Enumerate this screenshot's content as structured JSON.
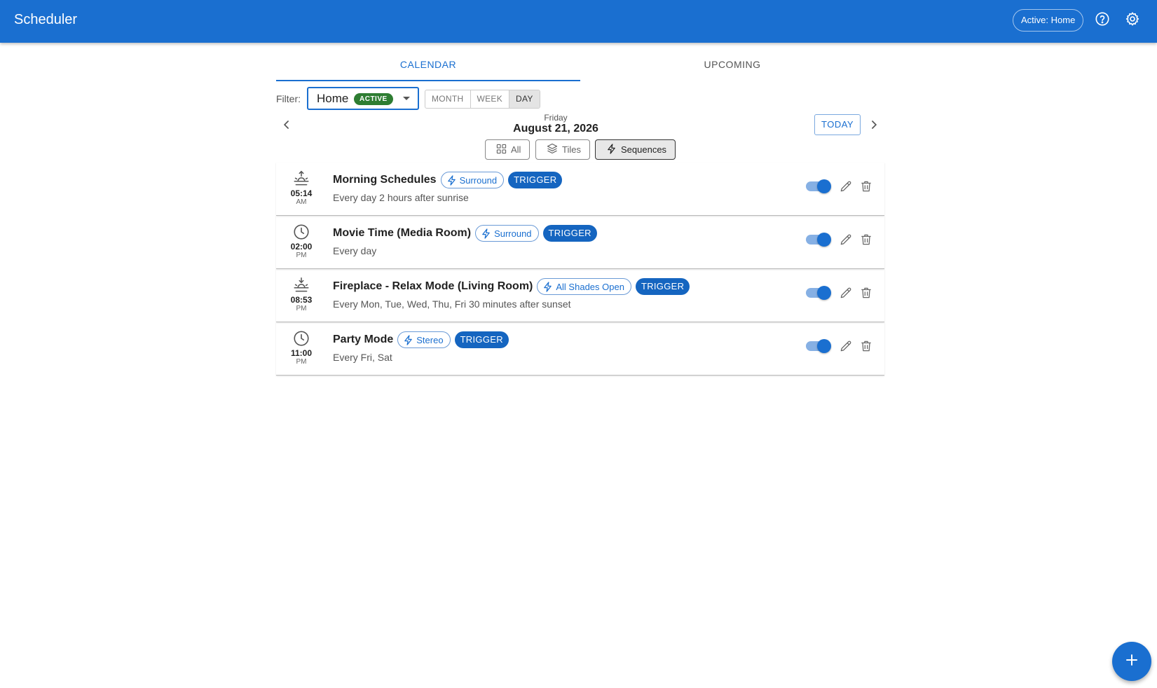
{
  "header": {
    "title": "Scheduler",
    "active_chip": "Active: Home",
    "help_icon": "help-circle-icon",
    "settings_icon": "gear-icon"
  },
  "tabs": [
    {
      "label": "CALENDAR",
      "selected": true
    },
    {
      "label": "UPCOMING",
      "selected": false
    }
  ],
  "filter": {
    "label": "Filter:",
    "value": "Home",
    "badge": "ACTIVE"
  },
  "view_modes": [
    {
      "label": "MONTH",
      "selected": false
    },
    {
      "label": "WEEK",
      "selected": false
    },
    {
      "label": "DAY",
      "selected": true
    }
  ],
  "date_nav": {
    "day_name": "Friday",
    "date": "August 21, 2026",
    "today_label": "TODAY"
  },
  "type_filters": [
    {
      "label": "All",
      "icon": "grid-icon",
      "selected": false
    },
    {
      "label": "Tiles",
      "icon": "layers-icon",
      "selected": false
    },
    {
      "label": "Sequences",
      "icon": "lightning-icon",
      "selected": true
    }
  ],
  "schedules": [
    {
      "time": "05:14",
      "period": "AM",
      "icon": "sunrise-icon",
      "title": "Morning Schedules",
      "sequence": "Surround",
      "tag": "TRIGGER",
      "description": "Every day 2 hours after sunrise",
      "enabled": true
    },
    {
      "time": "02:00",
      "period": "PM",
      "icon": "clock-icon",
      "title": "Movie Time (Media Room)",
      "sequence": "Surround",
      "tag": "TRIGGER",
      "description": "Every day",
      "enabled": true
    },
    {
      "time": "08:53",
      "period": "PM",
      "icon": "sunset-icon",
      "title": "Fireplace - Relax Mode (Living Room)",
      "sequence": "All Shades Open",
      "tag": "TRIGGER",
      "description": "Every Mon, Tue, Wed, Thu, Fri 30 minutes after sunset",
      "enabled": true
    },
    {
      "time": "11:00",
      "period": "PM",
      "icon": "clock-icon",
      "title": "Party Mode",
      "sequence": "Stereo",
      "tag": "TRIGGER",
      "description": "Every Fri, Sat",
      "enabled": true
    }
  ],
  "fab_icon": "plus-icon",
  "colors": {
    "primary": "#1a6fd0",
    "active_badge": "#2e7d32",
    "trigger": "#1565c0"
  }
}
